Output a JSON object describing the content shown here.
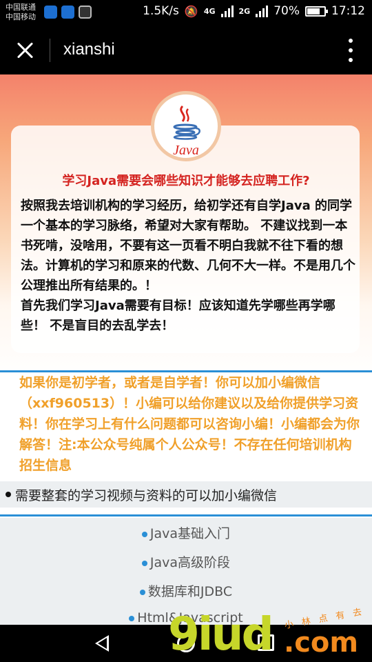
{
  "status_bar": {
    "carrier_1": "中国联通",
    "carrier_2": "中国移动",
    "speed": "1.5K/s",
    "network_1": "4G",
    "network_2": "4G",
    "network_3": "2G",
    "battery": "70%",
    "time": "17:12"
  },
  "title_bar": {
    "title": "xianshi"
  },
  "article": {
    "logo_text": "Java",
    "headline": "学习Java需要会哪些知识才能够去应聘工作?",
    "intro_1": "按照我去培训机构的学习经历，给初学还有自学Java 的同学一个基本的学习脉络，希望对大家有帮助。 不建议找到一本书死啃，没啥用，不要有这一页看不明白我就不往下看的想法。计算机的学习和原来的代数、几何不大一样。不是用几个公理推出所有结果的。！",
    "intro_2": "首先我们学习Java需要有目标！应该知道先学哪些再学哪些！ 不是盲目的去乱学去！",
    "notice": "如果你是初学者，或者是自学者！你可以加小编微信（xxf960513）！小编可以给你建议以及给你提供学习资料！你在学习上有什么问题都可以咨询小编！小编都会为你解答！注:本公众号纯属个人公众号！不存在任何培训机构招生信息",
    "promo": "需要整套的学习视频与资料的可以加小编微信"
  },
  "menu": {
    "items": [
      "Java基础入门",
      "Java高级阶段",
      "数据库和JDBC",
      "Html&Javascript"
    ]
  },
  "watermark": {
    "main": "9iud",
    "dotcom": ".com",
    "small": "小 林 点 有 去"
  },
  "colors": {
    "headline": "#d42320",
    "notice": "#f0a02a",
    "accent_blue": "#2a8fd6"
  }
}
